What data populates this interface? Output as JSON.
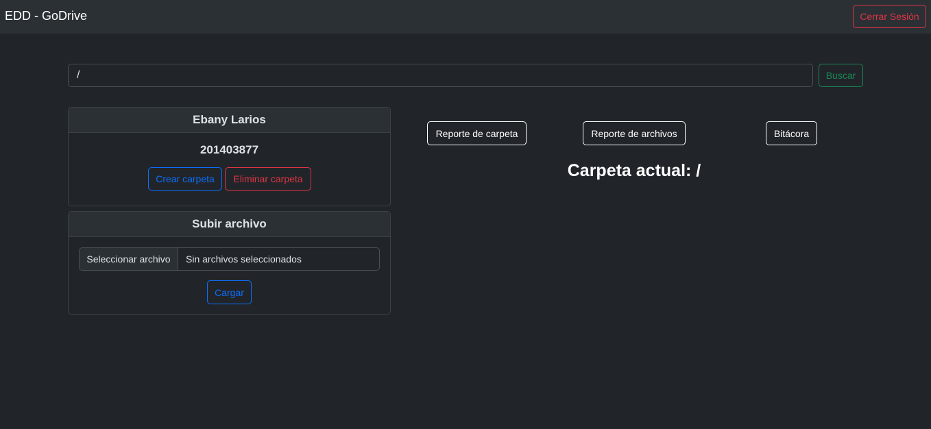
{
  "navbar": {
    "brand": "EDD - GoDrive",
    "logout_label": "Cerrar Sesión"
  },
  "search": {
    "value": "/",
    "button_label": "Buscar"
  },
  "user_card": {
    "name": "Ebany Larios",
    "id": "201403877",
    "create_label": "Crear carpeta",
    "delete_label": "Eliminar carpeta"
  },
  "upload_card": {
    "title": "Subir archivo",
    "select_label": "Seleccionar archivo",
    "no_file_label": "Sin archivos seleccionados",
    "load_label": "Cargar"
  },
  "reports": {
    "folder_report_label": "Reporte de carpeta",
    "files_report_label": "Reporte de archivos",
    "log_label": "Bitácora"
  },
  "current_folder": "Carpeta actual: /",
  "colors": {
    "background": "#212529",
    "navbar": "#2b3035",
    "danger": "#dc3545",
    "primary": "#0d6efd",
    "success": "#198754"
  }
}
